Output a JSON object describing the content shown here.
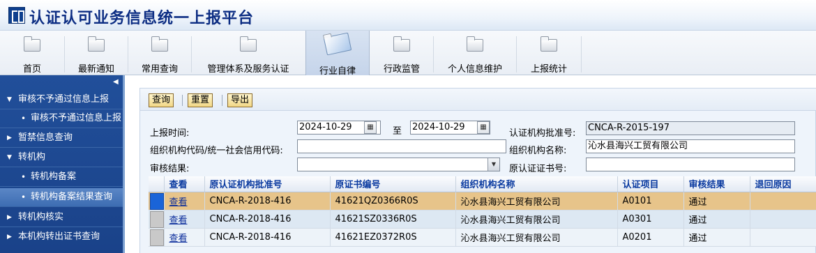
{
  "app": {
    "title": "认证认可业务信息统一上报平台"
  },
  "nav": {
    "items": [
      {
        "label": "首页"
      },
      {
        "label": "最新通知"
      },
      {
        "label": "常用查询"
      },
      {
        "label": "管理体系及服务认证"
      },
      {
        "label": "行业自律",
        "active": true
      },
      {
        "label": "行政监管"
      },
      {
        "label": "个人信息维护"
      },
      {
        "label": "上报统计"
      }
    ]
  },
  "sidebar": {
    "items": [
      {
        "label": "审核不予通过信息上报",
        "type": "group",
        "expanded": true
      },
      {
        "label": "审核不予通过信息上报",
        "type": "sub"
      },
      {
        "label": "暂禁信息查询",
        "type": "group",
        "expanded": false
      },
      {
        "label": "转机构",
        "type": "group",
        "expanded": true
      },
      {
        "label": "转机构备案",
        "type": "sub"
      },
      {
        "label": "转机构备案结果查询",
        "type": "sub",
        "selected": true
      },
      {
        "label": "转机构核实",
        "type": "group",
        "expanded": false
      },
      {
        "label": "本机构转出证书查询",
        "type": "group",
        "expanded": false
      }
    ]
  },
  "toolbar": {
    "query": "查询",
    "reset": "重置",
    "export": "导出"
  },
  "form": {
    "report_time_label": "上报时间:",
    "date_from": "2024-10-29",
    "to_label": "至",
    "date_to": "2024-10-29",
    "approval_no_label": "认证机构批准号:",
    "approval_no": "CNCA-R-2015-197",
    "org_code_label": "组织机构代码/统一社会信用代码:",
    "org_code": "",
    "org_name_label": "组织机构名称:",
    "org_name": "沁水县海兴工贸有限公司",
    "audit_result_label": "审核结果:",
    "audit_result": "",
    "orig_cert_label": "原认证证书号:",
    "orig_cert": ""
  },
  "grid": {
    "columns": [
      "查看",
      "原认证机构批准号",
      "原证书编号",
      "组织机构名称",
      "认证项目",
      "审核结果",
      "退回原因"
    ],
    "rows": [
      {
        "view": "查看",
        "orig_approval": "CNCA-R-2018-416",
        "orig_cert": "41621QZ0366R0S",
        "org": "沁水县海兴工贸有限公司",
        "project": "A0101",
        "result": "通过",
        "reason": ""
      },
      {
        "view": "查看",
        "orig_approval": "CNCA-R-2018-416",
        "orig_cert": "41621SZ0336R0S",
        "org": "沁水县海兴工贸有限公司",
        "project": "A0301",
        "result": "通过",
        "reason": ""
      },
      {
        "view": "查看",
        "orig_approval": "CNCA-R-2018-416",
        "orig_cert": "41621EZ0372R0S",
        "org": "沁水县海兴工贸有限公司",
        "project": "A0201",
        "result": "通过",
        "reason": ""
      }
    ]
  }
}
